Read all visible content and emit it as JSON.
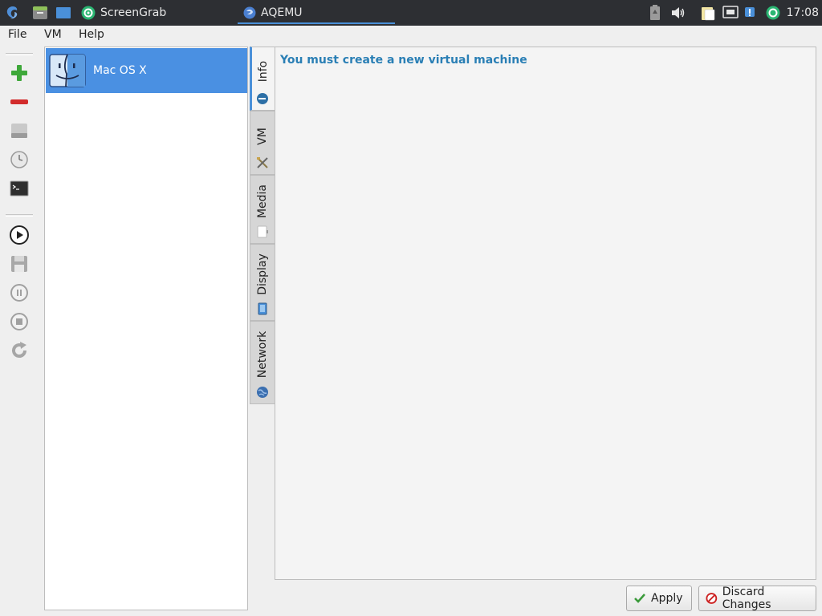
{
  "taskbar": {
    "apps": [
      {
        "label": "ScreenGrab",
        "icon": "screengrab-icon"
      },
      {
        "label": "AQEMU",
        "icon": "aqemu-icon"
      }
    ],
    "clock": "17:08"
  },
  "menubar": {
    "items": [
      "File",
      "VM",
      "Help"
    ]
  },
  "toolbar": {
    "icons": [
      "add-vm-icon",
      "remove-vm-icon",
      "hard-drive-icon",
      "clock-icon",
      "terminal-icon",
      "play-icon",
      "save-icon",
      "pause-icon",
      "stop-icon",
      "reload-icon"
    ]
  },
  "vm_list": {
    "items": [
      {
        "name": "Mac OS X",
        "icon": "mac-finder-icon",
        "selected": true
      }
    ]
  },
  "tabs": [
    {
      "label": "Info",
      "icon": "info-icon",
      "active": true
    },
    {
      "label": "VM",
      "icon": "tools-icon",
      "active": false
    },
    {
      "label": "Media",
      "icon": "media-icon",
      "active": false
    },
    {
      "label": "Display",
      "icon": "display-icon",
      "active": false
    },
    {
      "label": "Network",
      "icon": "network-icon",
      "active": false
    }
  ],
  "panel": {
    "message": "You must create a new virtual machine"
  },
  "buttons": {
    "apply": "Apply",
    "discard": "Discard Changes"
  },
  "colors": {
    "selection": "#4a90e2",
    "message": "#2a7fb5",
    "taskbar": "#2d2f33"
  }
}
